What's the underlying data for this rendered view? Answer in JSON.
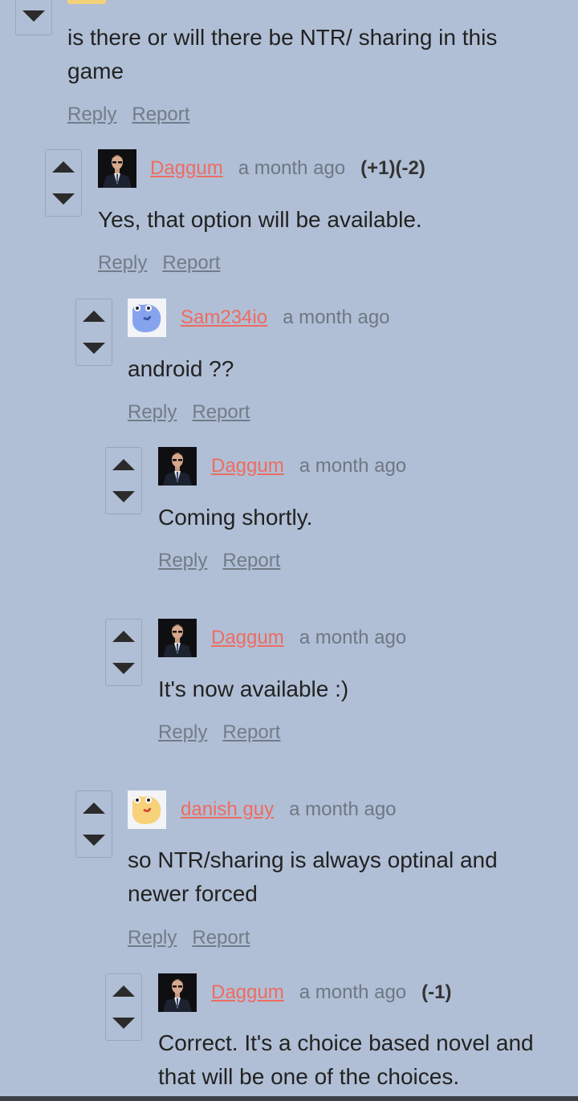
{
  "comments": [
    {
      "author": "",
      "time": "",
      "score": "",
      "text": "is there or will there be NTR/ sharing in this game",
      "reply": "Reply",
      "report": "Report"
    },
    {
      "author": "Daggum",
      "time": "a month ago",
      "score": "(+1)(-2)",
      "text": "Yes, that option will be available.",
      "reply": "Reply",
      "report": "Report",
      "avatar_icon": "suited-man-avatar"
    },
    {
      "author": "Sam234io",
      "time": "a month ago",
      "score": "",
      "text": "android ??",
      "reply": "Reply",
      "report": "Report",
      "avatar_icon": "blue-blob-avatar"
    },
    {
      "author": "Daggum",
      "time": "a month ago",
      "score": "",
      "text": "Coming shortly.",
      "reply": "Reply",
      "report": "Report",
      "avatar_icon": "suited-man-avatar"
    },
    {
      "author": "Daggum",
      "time": "a month ago",
      "score": "",
      "text": "It's now available :)",
      "reply": "Reply",
      "report": "Report",
      "avatar_icon": "suited-man-avatar"
    },
    {
      "author": "danish guy",
      "time": "a month ago",
      "score": "",
      "text": "so NTR/sharing is always optinal and newer forced",
      "reply": "Reply",
      "report": "Report",
      "avatar_icon": "yellow-blob-avatar"
    },
    {
      "author": "Daggum",
      "time": "a month ago",
      "score": "(-1)",
      "text": "Correct. It's a choice based novel and that will be one of the choices.",
      "avatar_icon": "suited-man-avatar"
    }
  ],
  "colors": {
    "background": "#b0bfd5",
    "author_link": "#ef6b61",
    "muted_link": "#727c89"
  }
}
